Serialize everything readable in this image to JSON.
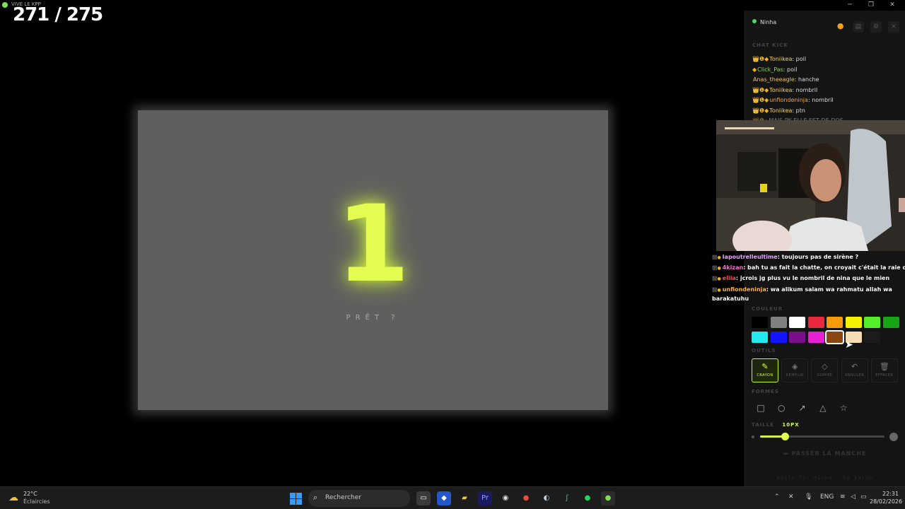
{
  "window": {
    "app_title": "VIVE LE KPP",
    "minimize": "─",
    "maximize": "❐",
    "close": "✕"
  },
  "game": {
    "counter": "271 / 275",
    "countdown": "1",
    "ready_label": "PRÊT ?"
  },
  "sidebar": {
    "username": "Ninha",
    "chat_label": "CHAT KICK",
    "chat_messages": [
      {
        "user": "Toniikea",
        "text": "poil",
        "user_color": "#f4d35e",
        "badges": "👑❶◆"
      },
      {
        "user": "Click_Pas",
        "text": "poil",
        "user_color": "#8fd16a",
        "badges": "◆"
      },
      {
        "user": "Anas_theeagle",
        "text": "hanche",
        "user_color": "#e9c46a",
        "badges": ""
      },
      {
        "user": "Toniikea",
        "text": "nombril",
        "user_color": "#f4d35e",
        "badges": "👑❶◆"
      },
      {
        "user": "unfiondeninja",
        "text": "nombril",
        "user_color": "#f7a440",
        "badges": "👑❶◆"
      },
      {
        "user": "Toniikea",
        "text": "ptn",
        "user_color": "#f4d35e",
        "badges": "👑❶◆"
      },
      {
        "user": "",
        "text": "MAIS PK ELLE EST DE DOS",
        "user_color": "#e74c3c",
        "badges": "👑❶"
      }
    ],
    "colors_label": "COULEUR",
    "tools_label": "OUTILS",
    "tools": [
      {
        "icon": "✎",
        "label": "CRAYON"
      },
      {
        "icon": "◈",
        "label": "REMPLIR"
      },
      {
        "icon": "◇",
        "label": "GOMME"
      },
      {
        "icon": "↶",
        "label": "ANNULER"
      },
      {
        "icon": "🗑",
        "label": "EFFACER"
      }
    ],
    "shapes_label": "FORMES",
    "shapes": [
      "□",
      "○",
      "↗",
      "△",
      "☆"
    ],
    "size_label": "TAILLE",
    "size_value": "10PX",
    "size_fraction": 0.2,
    "pass_button": "⏭ PASSER LA MANCHE",
    "credit": "built for ninha · by kaido"
  },
  "stream_overlay_chat": [
    {
      "user": "lapoutrelleultime",
      "text": "toujours pas de sirène ?",
      "user_color": "#e9a8ff"
    },
    {
      "user": "4kizan",
      "text": "bah tu as fait la chatte, on croyait c'était la raie du cul",
      "user_color": "#ff6bd0"
    },
    {
      "user": "eliia",
      "text": "jcrois jg plus vu le nombril de nina que le mien",
      "user_color": "#ff4d4d"
    },
    {
      "user": "unfiondeninja",
      "text": "wa alikum salam wa rahmatu allah wa barakatuhu",
      "user_color": "#ffb347"
    }
  ],
  "palette": {
    "row1": [
      "#000000",
      "#808080",
      "#ffffff",
      "#e8283c",
      "#f59a0a",
      "#f5f000",
      "#55ee2a",
      "#17a516"
    ],
    "row2": [
      "#22e8f0",
      "#1414ff",
      "#7a0f8a",
      "#e820d5",
      "#8b4513",
      "#f5deb3"
    ],
    "selected": "#8b4513",
    "accent": "#d5ff50"
  },
  "taskbar": {
    "temperature": "22°C",
    "weather": "Éclaircies",
    "search_placeholder": "Rechercher",
    "language": "ENG",
    "time": "22:31",
    "date": "28/02/2026"
  }
}
